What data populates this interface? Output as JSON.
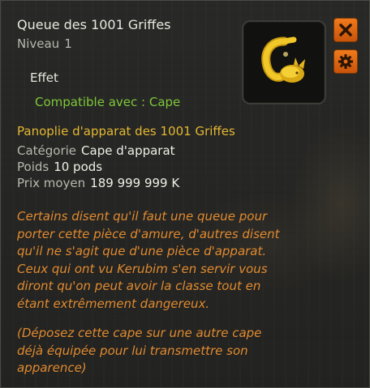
{
  "item": {
    "name": "Queue des 1001 Griffes",
    "level_label": "Niveau",
    "level_value": "1",
    "image_icon": "tail-item-icon"
  },
  "effect": {
    "heading": "Effet",
    "line": "Compatible avec : Cape"
  },
  "buttons": {
    "close_icon": "close-icon",
    "settings_icon": "gear-icon"
  },
  "set_name": "Panoplie d'apparat des 1001 Griffes",
  "stats": {
    "category_label": "Catégorie",
    "category_value": "Cape d'apparat",
    "weight_label": "Poids",
    "weight_value": "10 pods",
    "price_label": "Prix moyen",
    "price_value": "189 999 999 K"
  },
  "description_lines": [
    "Certains disent qu'il faut une queue pour",
    "porter cette pièce d'amure, d'autres disent",
    "qu'il ne s'agit que d'une pièce d'apparat.",
    "Ceux qui ont vu Kerubim s'en servir vous",
    "diront qu'on peut avoir la classe tout en",
    "étant extrêmement dangereux."
  ],
  "note_lines": [
    "(Déposez cette cape sur une autre cape",
    "déjà équipée pour lui transmettre son",
    "apparence)"
  ],
  "colors": {
    "title": "#e8e8e0",
    "effect_green": "#7ec83a",
    "set_gold": "#e4b832",
    "description_orange": "#e08a30",
    "button_orange": "#f07a1c"
  }
}
